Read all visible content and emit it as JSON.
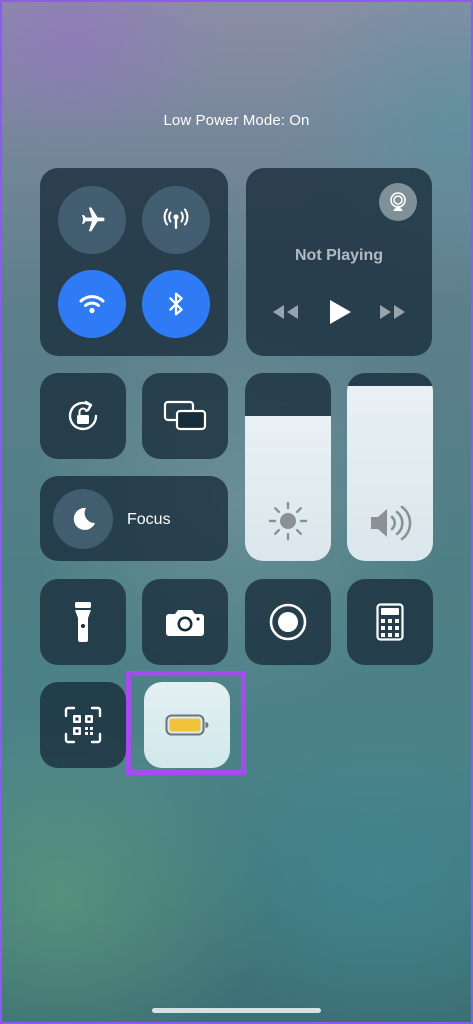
{
  "status_text": "Low Power Mode: On",
  "connectivity": {
    "airplane": {
      "icon": "airplane-icon",
      "state": "off"
    },
    "cellular": {
      "icon": "cellular-antenna-icon",
      "state": "off"
    },
    "wifi": {
      "icon": "wifi-icon",
      "state": "on"
    },
    "bluetooth": {
      "icon": "bluetooth-icon",
      "state": "on"
    }
  },
  "now_playing": {
    "title": "Not Playing",
    "airplay_icon": "airplay-icon",
    "controls": [
      "rewind-icon",
      "play-icon",
      "fast-forward-icon"
    ]
  },
  "controls": {
    "orientation_lock": {
      "icon": "orientation-lock-icon"
    },
    "screen_mirroring": {
      "icon": "screen-mirroring-icon"
    },
    "focus": {
      "label": "Focus",
      "icon": "moon-icon"
    },
    "brightness": {
      "icon": "sun-icon",
      "level": 0.77
    },
    "volume": {
      "icon": "speaker-icon",
      "level": 0.93
    },
    "flashlight": {
      "icon": "flashlight-icon"
    },
    "camera": {
      "icon": "camera-icon"
    },
    "screen_record": {
      "icon": "record-icon"
    },
    "calculator": {
      "icon": "calculator-icon"
    },
    "code_scanner": {
      "icon": "qr-scanner-icon"
    },
    "low_power": {
      "icon": "battery-icon",
      "state": "on"
    }
  },
  "colors": {
    "accent_blue": "#2f7bf6",
    "battery_yellow": "#f2c23a",
    "highlight": "#a64bf0"
  }
}
